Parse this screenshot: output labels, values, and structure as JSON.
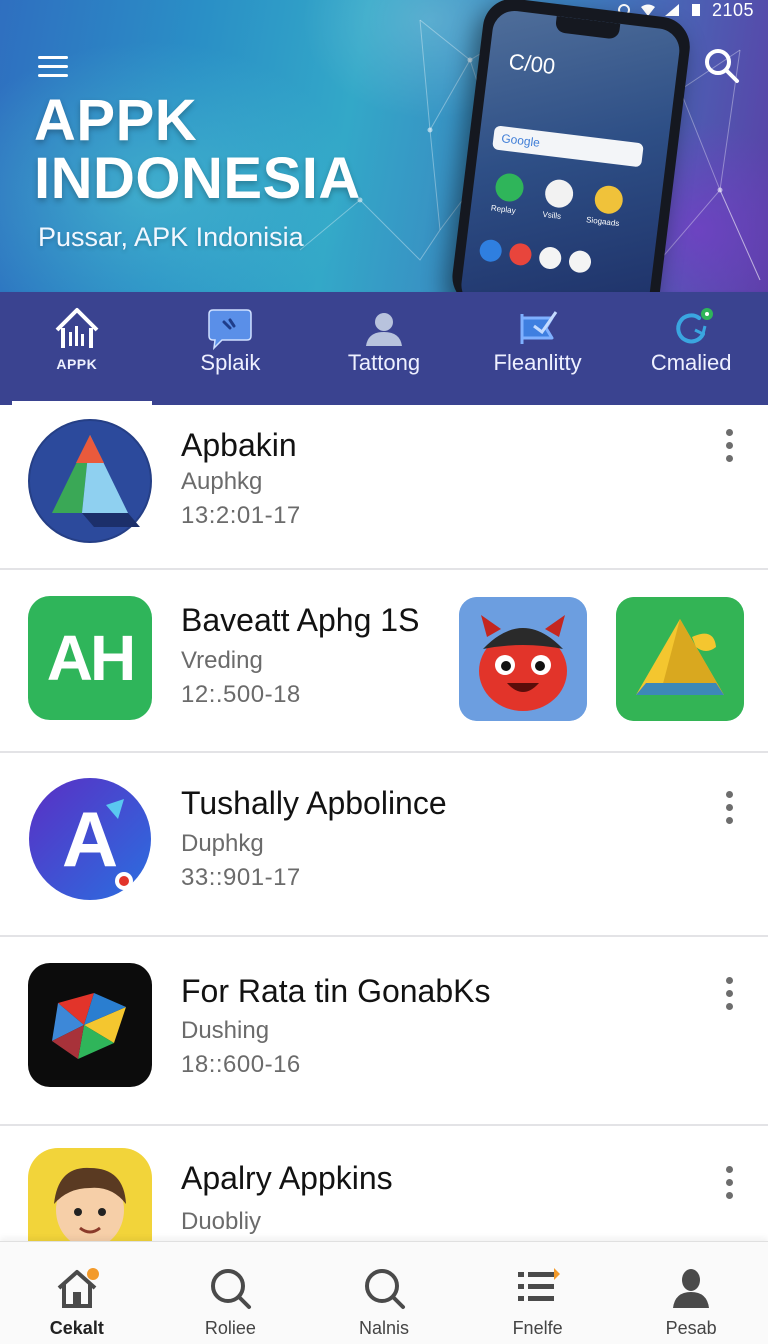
{
  "status_bar": {
    "time": "2105"
  },
  "header": {
    "title_line1": "APPK",
    "title_line2": "INDONESIA",
    "subtitle": "Pussar, APK Indonisia",
    "phone_clock": "C/00",
    "phone_search": "Google",
    "phone_app_labels": [
      "Replay",
      "Vsills",
      "Siogaads"
    ]
  },
  "tabs": [
    {
      "label": "APPK",
      "icon": "appk-logo-icon",
      "active": true
    },
    {
      "label": "Splaik",
      "icon": "chat-bubble-icon",
      "active": false
    },
    {
      "label": "Tattong",
      "icon": "person-icon",
      "active": false
    },
    {
      "label": "Fleanlitty",
      "icon": "flag-icon",
      "active": false
    },
    {
      "label": "Cmalied",
      "icon": "refresh-badge-icon",
      "active": false
    }
  ],
  "apps": [
    {
      "title": "Apbakin",
      "subtitle": "Auphkg",
      "date": "13:2:01-17",
      "icon": "triangle-logo-icon"
    },
    {
      "title": "Baveatt Aphg 1S",
      "subtitle": "Vreding",
      "date": "12:.500-18",
      "icon": "ah-logo-icon",
      "icon_text": "AH"
    },
    {
      "title": "Tushally Apbolince",
      "subtitle": "Duphkg",
      "date": "33::901-17",
      "icon": "a-logo-icon",
      "icon_text": "A"
    },
    {
      "title": "For Rata tin GonabKs",
      "subtitle": "Dushing",
      "date": "18::600-16",
      "icon": "star-shape-logo-icon"
    },
    {
      "title": "Apalry Appkins",
      "subtitle": "Duobliy",
      "icon": "boy-avatar-icon"
    }
  ],
  "featured_thumbs": [
    {
      "icon": "red-monster-icon"
    },
    {
      "icon": "yellow-a-logo-icon"
    }
  ],
  "bottom_nav": [
    {
      "label": "Cekalt",
      "icon": "home-icon",
      "active": true
    },
    {
      "label": "Roliee",
      "icon": "search-icon",
      "active": false
    },
    {
      "label": "Nalnis",
      "icon": "search-icon",
      "active": false
    },
    {
      "label": "Fnelfe",
      "icon": "list-icon",
      "active": false
    },
    {
      "label": "Pesab",
      "icon": "profile-icon",
      "active": false
    }
  ],
  "colors": {
    "tab_bar": "#3a4390",
    "hero_start": "#2f6fc0",
    "hero_end": "#5b3fa6",
    "green_icon": "#2fb55a",
    "divider": "#e3e3e6"
  }
}
